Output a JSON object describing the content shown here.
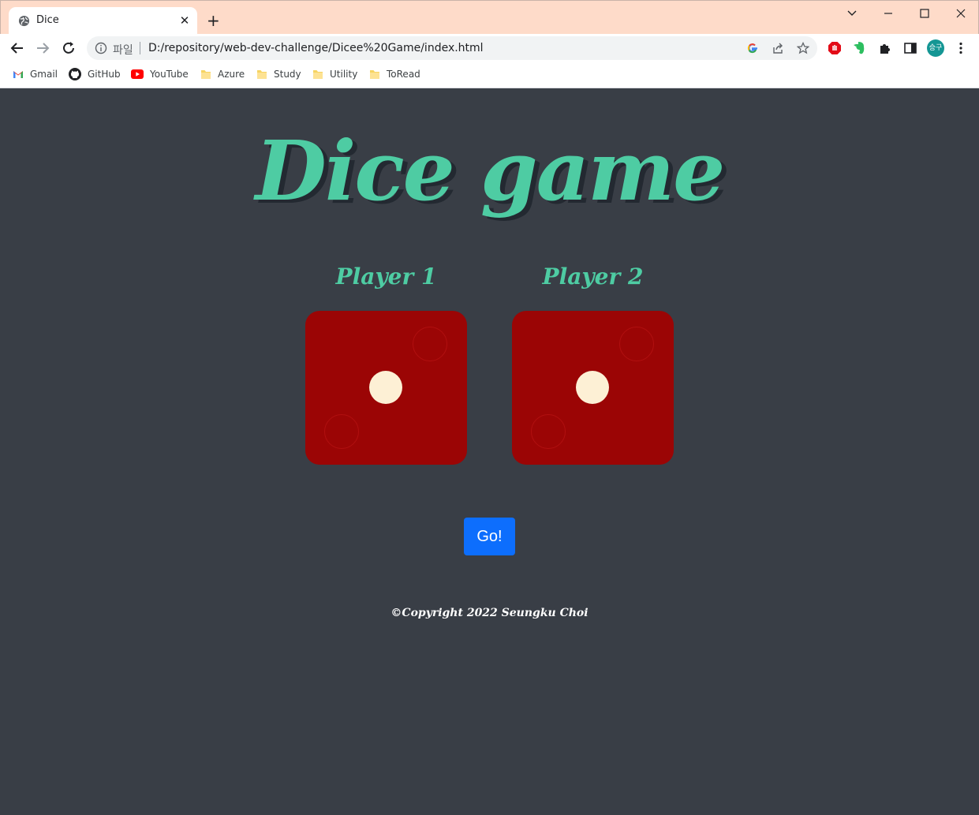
{
  "browser": {
    "tab": {
      "title": "Dice",
      "favicon": "globe-icon",
      "close_icon": "close-icon"
    },
    "new_tab_label": "+",
    "omnibox": {
      "scheme_label": "파일",
      "url": "D:/repository/web-dev-challenge/Dicee%20Game/index.html"
    },
    "profile_initials": "승구",
    "bookmarks": [
      {
        "label": "Gmail",
        "icon": "gmail-icon"
      },
      {
        "label": "GitHub",
        "icon": "github-icon"
      },
      {
        "label": "YouTube",
        "icon": "youtube-icon"
      },
      {
        "label": "Azure",
        "icon": "folder-icon"
      },
      {
        "label": "Study",
        "icon": "folder-icon"
      },
      {
        "label": "Utility",
        "icon": "folder-icon"
      },
      {
        "label": "ToRead",
        "icon": "folder-icon"
      }
    ]
  },
  "game": {
    "title": "Dice game",
    "players": [
      {
        "label": "Player 1",
        "die_value": 1
      },
      {
        "label": "Player 2",
        "die_value": 1
      }
    ],
    "button_label": "Go!",
    "copyright": "©Copyright 2022 Seungku Choi"
  },
  "colors": {
    "page_bg": "#393e46",
    "accent": "#4ecca3",
    "die": "#9b0505",
    "pip": "#fdf0d5",
    "button": "#0d6efd",
    "tabstrip": "#fedbc9"
  }
}
